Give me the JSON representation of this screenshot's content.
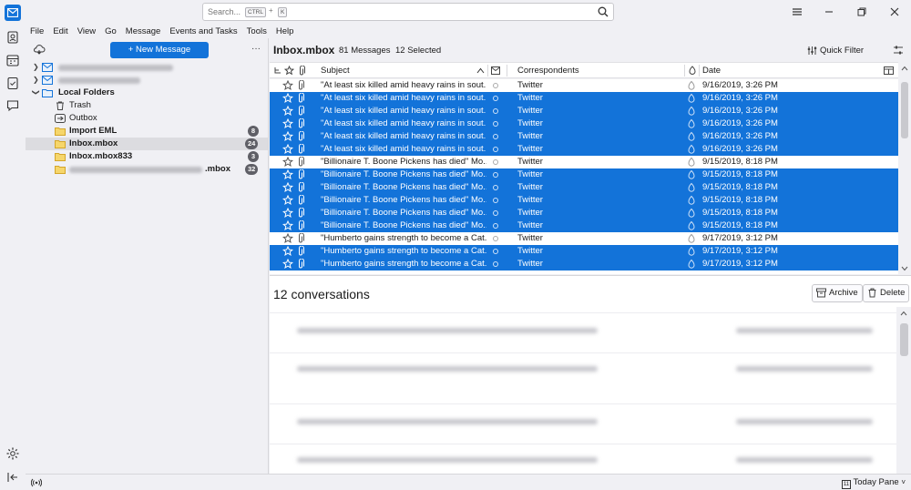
{
  "search": {
    "placeholder": "Search...",
    "kbd_ctrl": "CTRL",
    "kbd_plus": "+",
    "kbd_k": "K"
  },
  "menu": [
    "File",
    "Edit",
    "View",
    "Go",
    "Message",
    "Events and Tasks",
    "Tools",
    "Help"
  ],
  "folderpane": {
    "new_message": "New Message",
    "more": "···",
    "local_folders": "Local Folders",
    "folders": [
      {
        "name": "Trash",
        "badge": ""
      },
      {
        "name": "Outbox",
        "badge": ""
      },
      {
        "name": "Import EML",
        "badge": "8"
      },
      {
        "name": "Inbox.mbox",
        "badge": "24"
      },
      {
        "name": "Inbox.mbox833",
        "badge": "3"
      },
      {
        "name": ".mbox",
        "badge": "32"
      }
    ]
  },
  "thread": {
    "title": "Inbox.mbox",
    "count": "81 Messages",
    "selected": "12 Selected",
    "quick_filter": "Quick Filter",
    "col_subject": "Subject",
    "col_correspondents": "Correspondents",
    "col_date": "Date"
  },
  "messages": [
    {
      "subject": "\"At least six killed amid heavy rains in sout...",
      "corr": "Twitter",
      "date": "9/16/2019, 3:26 PM",
      "selected": false
    },
    {
      "subject": "\"At least six killed amid heavy rains in sout...",
      "corr": "Twitter",
      "date": "9/16/2019, 3:26 PM",
      "selected": true
    },
    {
      "subject": "\"At least six killed amid heavy rains in sout...",
      "corr": "Twitter",
      "date": "9/16/2019, 3:26 PM",
      "selected": true
    },
    {
      "subject": "\"At least six killed amid heavy rains in sout...",
      "corr": "Twitter",
      "date": "9/16/2019, 3:26 PM",
      "selected": true
    },
    {
      "subject": "\"At least six killed amid heavy rains in sout...",
      "corr": "Twitter",
      "date": "9/16/2019, 3:26 PM",
      "selected": true
    },
    {
      "subject": "\"At least six killed amid heavy rains in sout...",
      "corr": "Twitter",
      "date": "9/16/2019, 3:26 PM",
      "selected": true
    },
    {
      "subject": "\"Billionaire T. Boone Pickens has died\" Mo...",
      "corr": "Twitter",
      "date": "9/15/2019, 8:18 PM",
      "selected": false
    },
    {
      "subject": "\"Billionaire T. Boone Pickens has died\" Mo...",
      "corr": "Twitter",
      "date": "9/15/2019, 8:18 PM",
      "selected": true
    },
    {
      "subject": "\"Billionaire T. Boone Pickens has died\" Mo...",
      "corr": "Twitter",
      "date": "9/15/2019, 8:18 PM",
      "selected": true
    },
    {
      "subject": "\"Billionaire T. Boone Pickens has died\" Mo...",
      "corr": "Twitter",
      "date": "9/15/2019, 8:18 PM",
      "selected": true
    },
    {
      "subject": "\"Billionaire T. Boone Pickens has died\" Mo...",
      "corr": "Twitter",
      "date": "9/15/2019, 8:18 PM",
      "selected": true
    },
    {
      "subject": "\"Billionaire T. Boone Pickens has died\" Mo...",
      "corr": "Twitter",
      "date": "9/15/2019, 8:18 PM",
      "selected": true
    },
    {
      "subject": "\"Humberto gains strength to become a Cat...",
      "corr": "Twitter",
      "date": "9/17/2019, 3:12 PM",
      "selected": false
    },
    {
      "subject": "\"Humberto gains strength to become a Cat...",
      "corr": "Twitter",
      "date": "9/17/2019, 3:12 PM",
      "selected": true
    },
    {
      "subject": "\"Humberto gains strength to become a Cat...",
      "corr": "Twitter",
      "date": "9/17/2019, 3:12 PM",
      "selected": true
    }
  ],
  "preview": {
    "title": "12 conversations",
    "archive": "Archive",
    "delete": "Delete"
  },
  "status": {
    "today_pane": "Today Pane"
  },
  "colors": {
    "accent": "#1373d9",
    "selected_row": "#1373d9"
  }
}
